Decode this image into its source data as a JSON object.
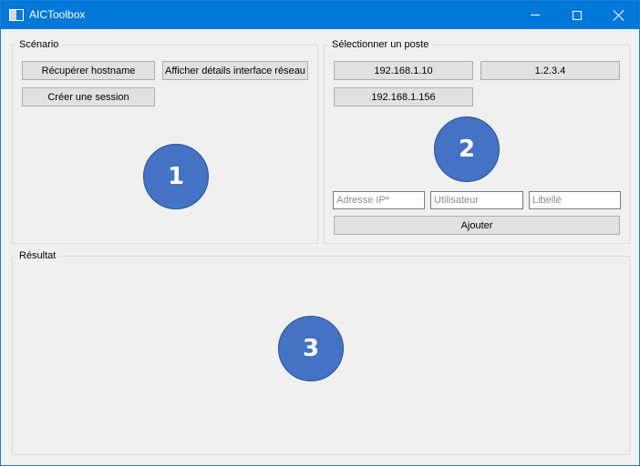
{
  "window": {
    "title": "AICToolbox",
    "icons": {
      "app": "app-window-icon",
      "minimize": "minimize-icon",
      "maximize": "maximize-icon",
      "close": "close-icon"
    }
  },
  "scenario": {
    "title": "Scénario",
    "buttons": [
      "Récupérer hostname",
      "Afficher détails interface réseau",
      "Créer une session"
    ],
    "badge": "1"
  },
  "poste": {
    "title": "Sélectionner un poste",
    "hosts": [
      "192.168.1.10",
      "1.2.3.4",
      "192.168.1.156"
    ],
    "badge": "2",
    "form": {
      "ip_placeholder": "Adresse IP*",
      "user_placeholder": "Utilisateur",
      "label_placeholder": "Libellé",
      "ip_value": "",
      "user_value": "",
      "label_value": "",
      "submit_label": "Ajouter"
    }
  },
  "result": {
    "title": "Résultat",
    "badge": "3"
  },
  "colors": {
    "titlebar": "#0078d7",
    "badge_fill": "#4472c4",
    "window_bg": "#f0f0f0"
  }
}
